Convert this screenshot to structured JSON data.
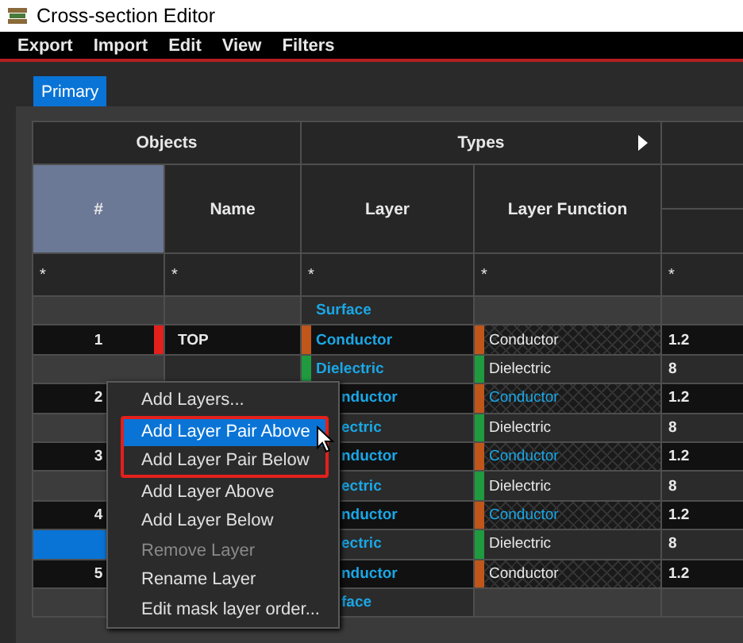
{
  "window": {
    "title": "Cross-section Editor"
  },
  "menu": [
    "Export",
    "Import",
    "Edit",
    "View",
    "Filters"
  ],
  "tabs": [
    {
      "label": "Primary",
      "selected": true
    }
  ],
  "table": {
    "groups": [
      {
        "label": "Objects",
        "expander": false
      },
      {
        "label": "Types",
        "expander": true
      }
    ],
    "columns": [
      "#",
      "Name",
      "Layer",
      "Layer Function"
    ],
    "filters": [
      "*",
      "*",
      "*",
      "*",
      "*"
    ],
    "rows": [
      {
        "kind": "surface",
        "layer": {
          "text": "Surface",
          "covered": false
        },
        "selected": false
      },
      {
        "kind": "conductor",
        "number": "1",
        "name": "TOP",
        "marker": {
          "color": "#e3201b"
        },
        "layer": {
          "text": "Conductor",
          "color": "#c0561a",
          "covered": false
        },
        "function": {
          "text": "Conductor",
          "color": "#c0561a",
          "highlight": false
        },
        "value": "1.2",
        "selected": false
      },
      {
        "kind": "dielectric",
        "layer": {
          "text": "Dielectric",
          "color": "#1f9a3f",
          "covered": false
        },
        "function": {
          "text": "Dielectric",
          "color": "#1f9a3f",
          "highlight": false
        },
        "value": "8",
        "selected": false
      },
      {
        "kind": "conductor",
        "number": "2",
        "layer": {
          "text": "nductor",
          "covered": true
        },
        "function": {
          "text": "Conductor",
          "color": "#c0561a",
          "highlight": true
        },
        "value": "1.2",
        "selected": false
      },
      {
        "kind": "dielectric",
        "layer": {
          "text": "ectric",
          "covered": true
        },
        "function": {
          "text": "Dielectric",
          "color": "#1f9a3f",
          "highlight": false
        },
        "value": "8",
        "selected": false
      },
      {
        "kind": "conductor",
        "number": "3",
        "layer": {
          "text": "nductor",
          "covered": true
        },
        "function": {
          "text": "Conductor",
          "color": "#c0561a",
          "highlight": true
        },
        "value": "1.2",
        "selected": false
      },
      {
        "kind": "dielectric",
        "layer": {
          "text": "ectric",
          "covered": true
        },
        "function": {
          "text": "Dielectric",
          "color": "#1f9a3f",
          "highlight": false
        },
        "value": "8",
        "selected": false
      },
      {
        "kind": "conductor",
        "number": "4",
        "layer": {
          "text": "nductor",
          "covered": true
        },
        "function": {
          "text": "Conductor",
          "color": "#c0561a",
          "highlight": true
        },
        "value": "1.2",
        "selected": false
      },
      {
        "kind": "dielectric",
        "layer": {
          "text": "ectric",
          "covered": true
        },
        "function": {
          "text": "Dielectric",
          "color": "#1f9a3f",
          "highlight": false
        },
        "value": "8",
        "selected": true
      },
      {
        "kind": "conductor",
        "number": "5",
        "layer": {
          "text": "nductor",
          "covered": true
        },
        "function": {
          "text": "Conductor",
          "color": "#c0561a",
          "highlight": false
        },
        "value": "1.2",
        "selected": false
      },
      {
        "kind": "surface",
        "layer": {
          "text": "face",
          "covered": true
        },
        "selected": false
      }
    ]
  },
  "context_menu": [
    {
      "label": "Add Layers...",
      "selected": false,
      "disabled": false,
      "outlined": false
    },
    {
      "label": "Add Layer Pair Above",
      "selected": true,
      "disabled": false,
      "outlined": true
    },
    {
      "label": "Add Layer Pair Below",
      "selected": false,
      "disabled": false,
      "outlined": true
    },
    {
      "label": "Add Layer Above",
      "selected": false,
      "disabled": false,
      "outlined": false
    },
    {
      "label": "Add Layer Below",
      "selected": false,
      "disabled": false,
      "outlined": false
    },
    {
      "label": "Remove Layer",
      "selected": false,
      "disabled": true,
      "outlined": false
    },
    {
      "label": "Rename Layer",
      "selected": false,
      "disabled": false,
      "outlined": false
    },
    {
      "label": "Edit mask layer order...",
      "selected": false,
      "disabled": false,
      "outlined": false
    }
  ]
}
